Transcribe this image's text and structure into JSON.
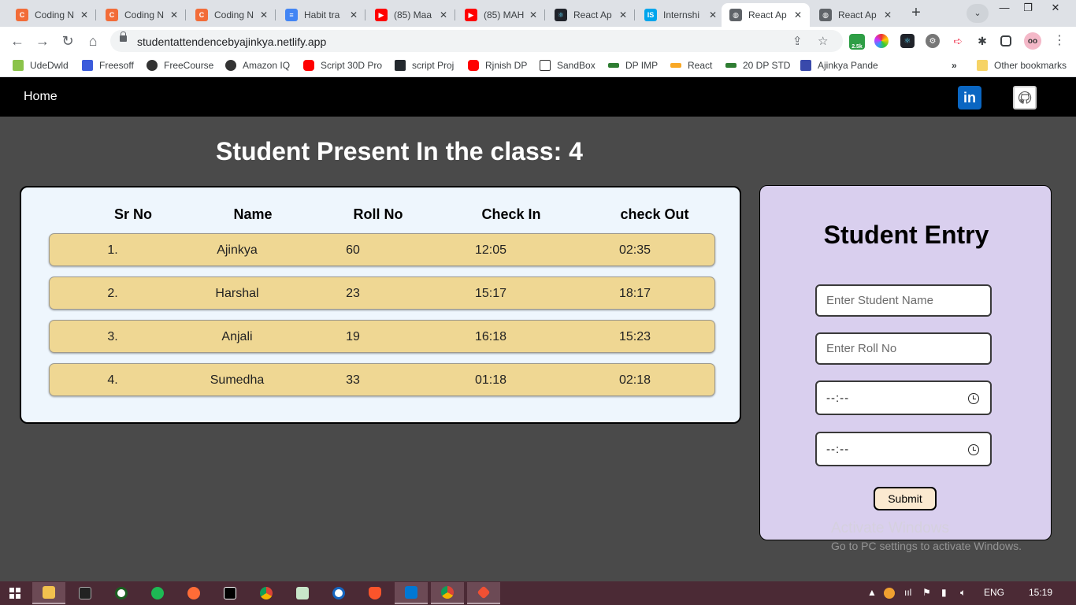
{
  "browser": {
    "tabs": [
      {
        "title": "Coding N",
        "icon": "coding-ninjas-icon",
        "color": "#f26c38"
      },
      {
        "title": "Coding N",
        "icon": "coding-ninjas-icon",
        "color": "#f26c38"
      },
      {
        "title": "Coding N",
        "icon": "coding-ninjas-icon",
        "color": "#f26c38"
      },
      {
        "title": "Habit tra",
        "icon": "google-docs-icon",
        "color": "#4285f4"
      },
      {
        "title": "(85) Maa",
        "icon": "youtube-icon",
        "color": "#ff0000"
      },
      {
        "title": "(85) MAH",
        "icon": "youtube-icon",
        "color": "#ff0000"
      },
      {
        "title": "React Ap",
        "icon": "react-icon",
        "color": "#20232a"
      },
      {
        "title": "Internshi",
        "icon": "internshala-icon",
        "color": "#00a5ec"
      },
      {
        "title": "React Ap",
        "icon": "globe-icon",
        "color": "#5f6368"
      },
      {
        "title": "React Ap",
        "icon": "globe-icon",
        "color": "#5f6368"
      }
    ],
    "active_tab_index": 8,
    "url": "studentattendencebyajinkya.netlify.app",
    "extension_badge": "2.5k",
    "bookmarks": [
      {
        "label": "UdeDwld",
        "icon": "bookmark-icon"
      },
      {
        "label": "Freesoff",
        "icon": "bookmark-icon"
      },
      {
        "label": "FreeCourse",
        "icon": "globe-icon"
      },
      {
        "label": "Amazon IQ",
        "icon": "globe-icon"
      },
      {
        "label": "Script 30D Pro",
        "icon": "youtube-icon"
      },
      {
        "label": "script Proj",
        "icon": "bookmark-icon"
      },
      {
        "label": "Rjnish DP",
        "icon": "youtube-icon"
      },
      {
        "label": "SandBox",
        "icon": "bookmark-icon"
      },
      {
        "label": "DP IMP",
        "icon": "bookmark-icon"
      },
      {
        "label": "React",
        "icon": "bookmark-icon"
      },
      {
        "label": "20 DP STD",
        "icon": "bookmark-icon"
      },
      {
        "label": "Ajinkya Pande",
        "icon": "bookmark-icon"
      }
    ],
    "more_bookmarks": "»",
    "other_bookmarks": "Other bookmarks"
  },
  "app": {
    "nav": {
      "home": "Home"
    },
    "heading": "Student Present In the class: 4",
    "table": {
      "headers": [
        "Sr No",
        "Name",
        "Roll No",
        "Check In",
        "check Out"
      ],
      "rows": [
        [
          "1.",
          "Ajinkya",
          "60",
          "12:05",
          "02:35"
        ],
        [
          "2.",
          "Harshal",
          "23",
          "15:17",
          "18:17"
        ],
        [
          "3.",
          "Anjali",
          "19",
          "16:18",
          "15:23"
        ],
        [
          "4.",
          "Sumedha",
          "33",
          "01:18",
          "02:18"
        ]
      ]
    },
    "entry": {
      "title": "Student Entry",
      "name_placeholder": "Enter Student Name",
      "roll_placeholder": "Enter Roll No",
      "checkin_value": "--:--",
      "checkout_value": "--:--",
      "submit": "Submit"
    }
  },
  "watermark": {
    "line1": "Activate Windows",
    "line2": "Go to PC settings to activate Windows."
  },
  "taskbar": {
    "language": "ENG",
    "time": "15:19"
  },
  "colors": {
    "page_bg": "#4a4a4a",
    "row_bg": "#efd793",
    "table_card_bg": "#eef6fd",
    "entry_card_bg": "#d9cfee",
    "submit_bg": "#fbe9d0"
  }
}
